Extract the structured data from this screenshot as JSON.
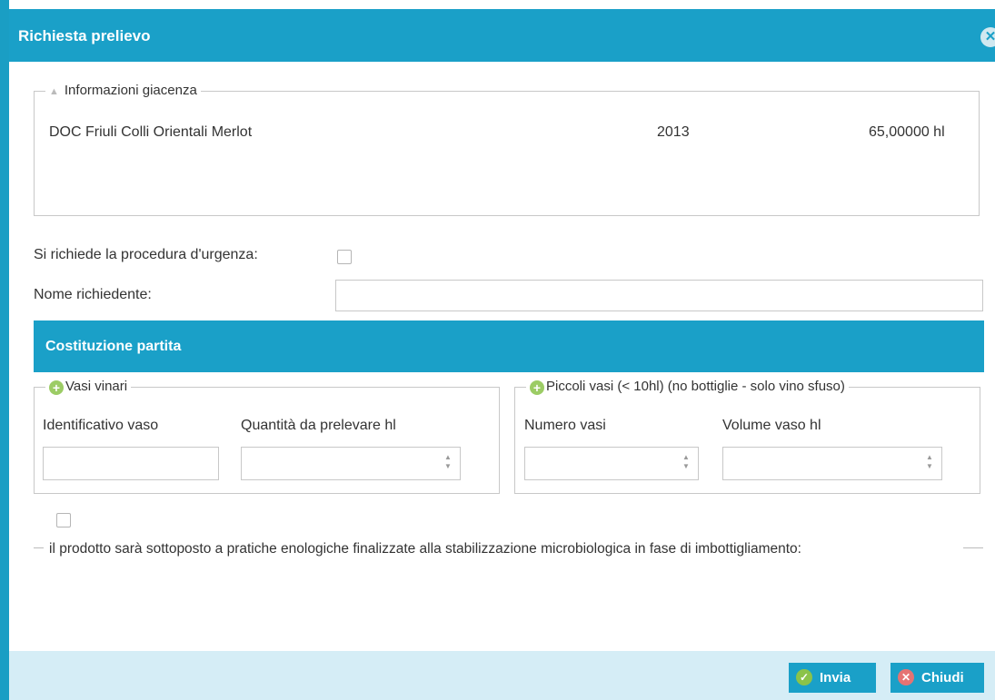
{
  "dialog": {
    "title": "Richiesta prelievo",
    "close_icon": "close-x-icon"
  },
  "info_section": {
    "legend": "Informazioni giacenza",
    "product": "DOC Friuli Colli Orientali Merlot",
    "year": "2013",
    "quantity": "65,00000 hl"
  },
  "form": {
    "urgency_label": "Si richiede la procedura d'urgenza:",
    "urgency_checked": false,
    "requester_label": "Nome richiedente:",
    "requester_value": ""
  },
  "costituzione": {
    "header": "Costituzione partita",
    "vasi_vinari": {
      "legend": "Vasi vinari",
      "col1_label": "Identificativo vaso",
      "col2_label": "Quantità da prelevare hl"
    },
    "piccoli_vasi": {
      "legend": "Piccoli vasi (< 10hl) (no bottiglie - solo vino sfuso)",
      "col1_label": "Numero vasi",
      "col2_label": "Volume vaso hl"
    }
  },
  "stabilization": {
    "checked": false,
    "text": "il prodotto sarà sottoposto a pratiche enologiche finalizzate alla stabilizzazione microbiologica in fase di imbottigliamento:"
  },
  "footer": {
    "send_label": "Invia",
    "close_label": "Chiudi"
  },
  "colors": {
    "accent": "#1aa0c8",
    "footer_bg": "#d5edf6",
    "send_icon": "#8bc34a",
    "close_icon": "#e57373"
  }
}
